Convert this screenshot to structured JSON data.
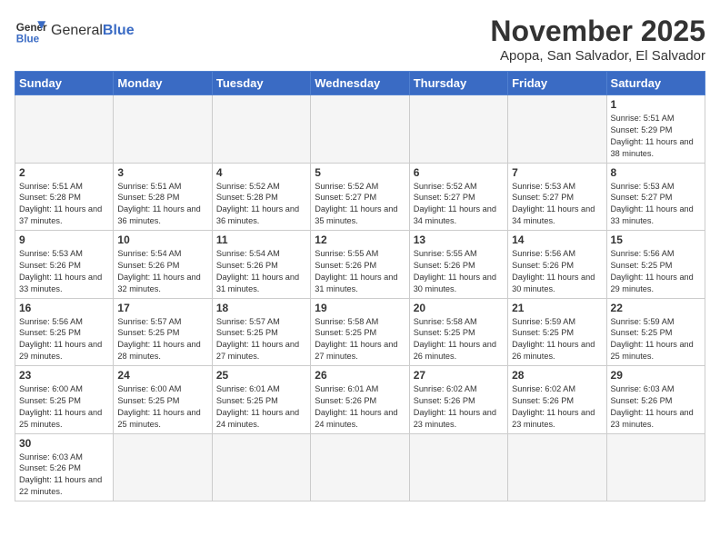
{
  "header": {
    "logo_general": "General",
    "logo_blue": "Blue",
    "month_title": "November 2025",
    "location": "Apopa, San Salvador, El Salvador"
  },
  "weekdays": [
    "Sunday",
    "Monday",
    "Tuesday",
    "Wednesday",
    "Thursday",
    "Friday",
    "Saturday"
  ],
  "weeks": [
    [
      {
        "day": "",
        "info": ""
      },
      {
        "day": "",
        "info": ""
      },
      {
        "day": "",
        "info": ""
      },
      {
        "day": "",
        "info": ""
      },
      {
        "day": "",
        "info": ""
      },
      {
        "day": "",
        "info": ""
      },
      {
        "day": "1",
        "info": "Sunrise: 5:51 AM\nSunset: 5:29 PM\nDaylight: 11 hours and 38 minutes."
      }
    ],
    [
      {
        "day": "2",
        "info": "Sunrise: 5:51 AM\nSunset: 5:28 PM\nDaylight: 11 hours and 37 minutes."
      },
      {
        "day": "3",
        "info": "Sunrise: 5:51 AM\nSunset: 5:28 PM\nDaylight: 11 hours and 36 minutes."
      },
      {
        "day": "4",
        "info": "Sunrise: 5:52 AM\nSunset: 5:28 PM\nDaylight: 11 hours and 36 minutes."
      },
      {
        "day": "5",
        "info": "Sunrise: 5:52 AM\nSunset: 5:27 PM\nDaylight: 11 hours and 35 minutes."
      },
      {
        "day": "6",
        "info": "Sunrise: 5:52 AM\nSunset: 5:27 PM\nDaylight: 11 hours and 34 minutes."
      },
      {
        "day": "7",
        "info": "Sunrise: 5:53 AM\nSunset: 5:27 PM\nDaylight: 11 hours and 34 minutes."
      },
      {
        "day": "8",
        "info": "Sunrise: 5:53 AM\nSunset: 5:27 PM\nDaylight: 11 hours and 33 minutes."
      }
    ],
    [
      {
        "day": "9",
        "info": "Sunrise: 5:53 AM\nSunset: 5:26 PM\nDaylight: 11 hours and 33 minutes."
      },
      {
        "day": "10",
        "info": "Sunrise: 5:54 AM\nSunset: 5:26 PM\nDaylight: 11 hours and 32 minutes."
      },
      {
        "day": "11",
        "info": "Sunrise: 5:54 AM\nSunset: 5:26 PM\nDaylight: 11 hours and 31 minutes."
      },
      {
        "day": "12",
        "info": "Sunrise: 5:55 AM\nSunset: 5:26 PM\nDaylight: 11 hours and 31 minutes."
      },
      {
        "day": "13",
        "info": "Sunrise: 5:55 AM\nSunset: 5:26 PM\nDaylight: 11 hours and 30 minutes."
      },
      {
        "day": "14",
        "info": "Sunrise: 5:56 AM\nSunset: 5:26 PM\nDaylight: 11 hours and 30 minutes."
      },
      {
        "day": "15",
        "info": "Sunrise: 5:56 AM\nSunset: 5:25 PM\nDaylight: 11 hours and 29 minutes."
      }
    ],
    [
      {
        "day": "16",
        "info": "Sunrise: 5:56 AM\nSunset: 5:25 PM\nDaylight: 11 hours and 29 minutes."
      },
      {
        "day": "17",
        "info": "Sunrise: 5:57 AM\nSunset: 5:25 PM\nDaylight: 11 hours and 28 minutes."
      },
      {
        "day": "18",
        "info": "Sunrise: 5:57 AM\nSunset: 5:25 PM\nDaylight: 11 hours and 27 minutes."
      },
      {
        "day": "19",
        "info": "Sunrise: 5:58 AM\nSunset: 5:25 PM\nDaylight: 11 hours and 27 minutes."
      },
      {
        "day": "20",
        "info": "Sunrise: 5:58 AM\nSunset: 5:25 PM\nDaylight: 11 hours and 26 minutes."
      },
      {
        "day": "21",
        "info": "Sunrise: 5:59 AM\nSunset: 5:25 PM\nDaylight: 11 hours and 26 minutes."
      },
      {
        "day": "22",
        "info": "Sunrise: 5:59 AM\nSunset: 5:25 PM\nDaylight: 11 hours and 25 minutes."
      }
    ],
    [
      {
        "day": "23",
        "info": "Sunrise: 6:00 AM\nSunset: 5:25 PM\nDaylight: 11 hours and 25 minutes."
      },
      {
        "day": "24",
        "info": "Sunrise: 6:00 AM\nSunset: 5:25 PM\nDaylight: 11 hours and 25 minutes."
      },
      {
        "day": "25",
        "info": "Sunrise: 6:01 AM\nSunset: 5:25 PM\nDaylight: 11 hours and 24 minutes."
      },
      {
        "day": "26",
        "info": "Sunrise: 6:01 AM\nSunset: 5:26 PM\nDaylight: 11 hours and 24 minutes."
      },
      {
        "day": "27",
        "info": "Sunrise: 6:02 AM\nSunset: 5:26 PM\nDaylight: 11 hours and 23 minutes."
      },
      {
        "day": "28",
        "info": "Sunrise: 6:02 AM\nSunset: 5:26 PM\nDaylight: 11 hours and 23 minutes."
      },
      {
        "day": "29",
        "info": "Sunrise: 6:03 AM\nSunset: 5:26 PM\nDaylight: 11 hours and 23 minutes."
      }
    ],
    [
      {
        "day": "30",
        "info": "Sunrise: 6:03 AM\nSunset: 5:26 PM\nDaylight: 11 hours and 22 minutes."
      },
      {
        "day": "",
        "info": ""
      },
      {
        "day": "",
        "info": ""
      },
      {
        "day": "",
        "info": ""
      },
      {
        "day": "",
        "info": ""
      },
      {
        "day": "",
        "info": ""
      },
      {
        "day": "",
        "info": ""
      }
    ]
  ]
}
